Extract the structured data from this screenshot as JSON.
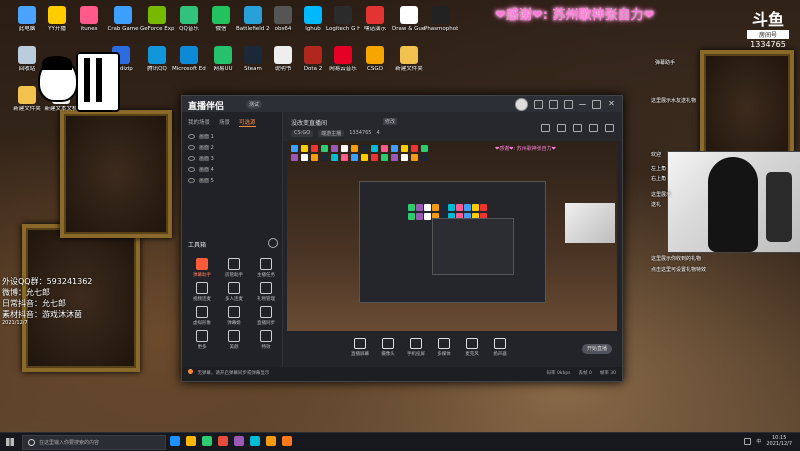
{
  "banner": {
    "text": "❤感谢❤: 苏州歌神张自力❤"
  },
  "brand": {
    "logo": "斗鱼",
    "room_label": "房间号",
    "room_number": "1334765"
  },
  "desktop_icons": [
    {
      "label": "此电脑",
      "color": "#4aa3ff"
    },
    {
      "label": "YY开播",
      "color": "#ffcc00"
    },
    {
      "label": "itunes",
      "color": "#ff5a8a"
    },
    {
      "label": "Crab Game",
      "color": "#3da0ff"
    },
    {
      "label": "GeForce Experience",
      "color": "#76b900"
    },
    {
      "label": "QQ音乐",
      "color": "#31c27c"
    },
    {
      "label": "微信",
      "color": "#22c35e"
    },
    {
      "label": "Battlefield 2042",
      "color": "#2aa0d8"
    },
    {
      "label": "obs64",
      "color": "#555555"
    },
    {
      "label": "lghub",
      "color": "#00b8fc"
    },
    {
      "label": "Logitech G HUB",
      "color": "#2b2b2b"
    },
    {
      "label": "嘿话演示",
      "color": "#e33333"
    },
    {
      "label": "Draw & Guess",
      "color": "#ffffff"
    },
    {
      "label": "Phasmophobia",
      "color": "#222222"
    },
    {
      "label": "回收站",
      "color": "#bbccdd"
    },
    {
      "label": "Bandizip",
      "color": "#2d6cdf"
    },
    {
      "label": "腾讯QQ",
      "color": "#1296db"
    },
    {
      "label": "Microsoft Edge",
      "color": "#0c8ad6"
    },
    {
      "label": "网易UU",
      "color": "#25c26b"
    },
    {
      "label": "Steam",
      "color": "#1b2838"
    },
    {
      "label": "说明书",
      "color": "#eeeeee"
    },
    {
      "label": "Dota 2",
      "color": "#b1261d"
    },
    {
      "label": "网易云音乐",
      "color": "#e60026"
    },
    {
      "label": "CSGO",
      "color": "#f7a600"
    },
    {
      "label": "新建文件夹",
      "color": "#f2c14e"
    },
    {
      "label": "新建文件夹",
      "color": "#f2c14e"
    },
    {
      "label": "新建文本文档",
      "color": "#f4f4f4"
    }
  ],
  "info": {
    "line1": "外设QQ群：593241362",
    "line2": "微博：允七郎",
    "line3": "日常抖音：允七郎",
    "line4": "素材抖音：游戏沐沐菌",
    "small": "2021/12/7"
  },
  "app": {
    "logo": "直播伴侣",
    "badge": "测试",
    "side_tabs": [
      "我的场景",
      "场景",
      "可选源"
    ],
    "scenes": [
      "画面 1",
      "画面 2",
      "画面 3",
      "画面 4",
      "画面 5"
    ],
    "tools_title": "工具箱",
    "tools": [
      {
        "label": "弹幕助手",
        "hi": true
      },
      {
        "label": "房管助手",
        "hi": false
      },
      {
        "label": "主播任务",
        "hi": false
      },
      {
        "label": "视频连麦",
        "hi": false
      },
      {
        "label": "多人连麦",
        "hi": false
      },
      {
        "label": "礼物管理",
        "hi": false
      },
      {
        "label": "虚拟形象",
        "hi": false
      },
      {
        "label": "弹幕姬",
        "hi": false
      },
      {
        "label": "直播同步",
        "hi": false
      },
      {
        "label": "更多",
        "hi": false
      },
      {
        "label": "美颜",
        "hi": false
      },
      {
        "label": "特效",
        "hi": false
      }
    ],
    "stream_title": "没改变直播间",
    "edit_tag": "修改",
    "meta": {
      "game": "CS:GO",
      "tag": "端游主播",
      "viewers": "1334765",
      "likes": "4"
    },
    "controls": [
      {
        "label": "直播屏幕"
      },
      {
        "label": "摄像头"
      },
      {
        "label": "手机投屏"
      },
      {
        "label": "多媒体"
      },
      {
        "label": "麦克风"
      },
      {
        "label": "扬声器"
      }
    ],
    "start_label": "开始直播",
    "status_notice": "无弹幕，请开启弹幕同步或弹幕显示",
    "status_right": [
      "码率 0kbps",
      "丢帧 0",
      "帧率 30"
    ]
  },
  "chat": [
    "弹幕助手",
    "这里展示水友送礼物",
    "欢迎",
    "左上角",
    "右上角",
    "这里展示",
    "送礼",
    "这里展示你收到的礼物",
    "点击这里可设置礼物特效"
  ],
  "taskbar": {
    "search_placeholder": "在这里输入你要搜索的内容",
    "icon_colors": [
      "#1e90ff",
      "#ffb703",
      "#2ecc71",
      "#e74c3c",
      "#9b59b6",
      "#00bcd4",
      "#f39c12",
      "#ff7a1a"
    ],
    "time": "10:15",
    "date": "2021/12/7",
    "lang": "中"
  }
}
